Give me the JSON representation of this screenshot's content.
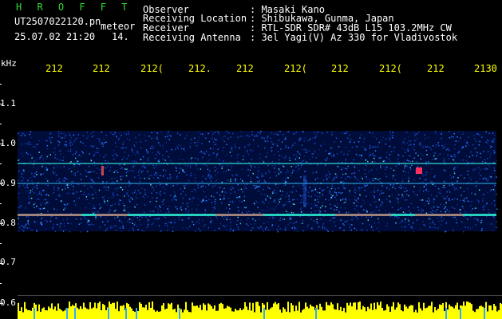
{
  "header": {
    "brand": "H R O F F T",
    "filename": "UT2507022120.pn",
    "meteor": "meteor",
    "datetime": "25.07.02 21:20",
    "count": "14.",
    "info": [
      {
        "label": "Observer",
        "value": ": Masaki Kano"
      },
      {
        "label": "Receiving Location",
        "value": ": Shibukawa, Gunma, Japan"
      },
      {
        "label": "Receiver",
        "value": ": RTL-SDR SDR# 43dB L15 103.2MHz CW"
      },
      {
        "label": "Receiving Antenna",
        "value": ": 3el Yagi(V) Az 330 for Vladivostok"
      }
    ]
  },
  "freq_axis": {
    "unit": "kHz",
    "ticks": [
      "1.1",
      "1.0",
      "0.9",
      "0.8",
      "0.7",
      "0.6"
    ]
  },
  "time_axis": {
    "ticks": [
      "212",
      "212",
      "212(",
      "212.",
      "212",
      "212(",
      "212",
      "212(",
      "212",
      "2130"
    ]
  },
  "colors": {
    "background": "#000000",
    "brand": "#33dd33",
    "time_labels": "#ffff00",
    "noise": "#ffff00"
  }
}
